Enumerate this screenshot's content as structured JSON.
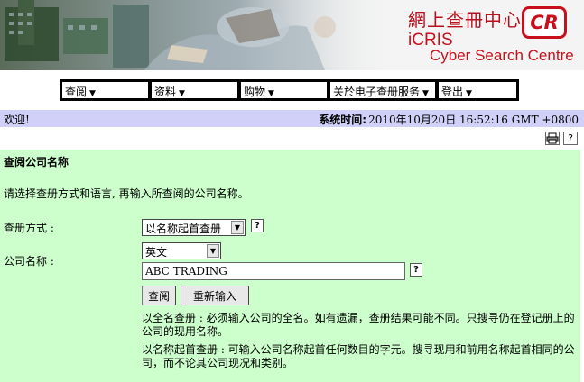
{
  "banner": {
    "brand_cn": "網上查冊中心",
    "logo_text": "CR",
    "brand_en_line1": "iCRIS",
    "brand_en_line2": "Cyber Search Centre"
  },
  "nav": {
    "items": [
      {
        "label": "查阅"
      },
      {
        "label": "资料"
      },
      {
        "label": "购物"
      },
      {
        "label": "关於电子查册服务"
      },
      {
        "label": "登出"
      }
    ]
  },
  "info_bar": {
    "welcome": "欢迎!",
    "system_time_label": "系统时间:",
    "system_time_value": "2010年10月20日 16:52:16 GMT +0800"
  },
  "tools": {
    "print_icon": "printer-icon",
    "help_icon": "help-icon"
  },
  "form": {
    "title": "查阅公司名称",
    "intro": "请选择查册方式和语言, 再输入所查阅的公司名称。",
    "search_method_label": "查册方式 :",
    "search_method_value": "以名称起首查册",
    "company_name_label": "公司名称 :",
    "language_value": "英文",
    "company_name_value": "ABC TRADING",
    "search_button": "查阅",
    "reset_button": "重新输入",
    "note1": "以全名查册 : 必须输入公司的全名。如有遗漏，查册结果可能不同。只搜寻仍在登记册上的公司的现用名称。",
    "note2": "以名称起首查册 : 可输入公司名称起首任何数目的字元。搜寻现用和前用名称起首相同的公司，而不论其公司现况和类别。"
  }
}
